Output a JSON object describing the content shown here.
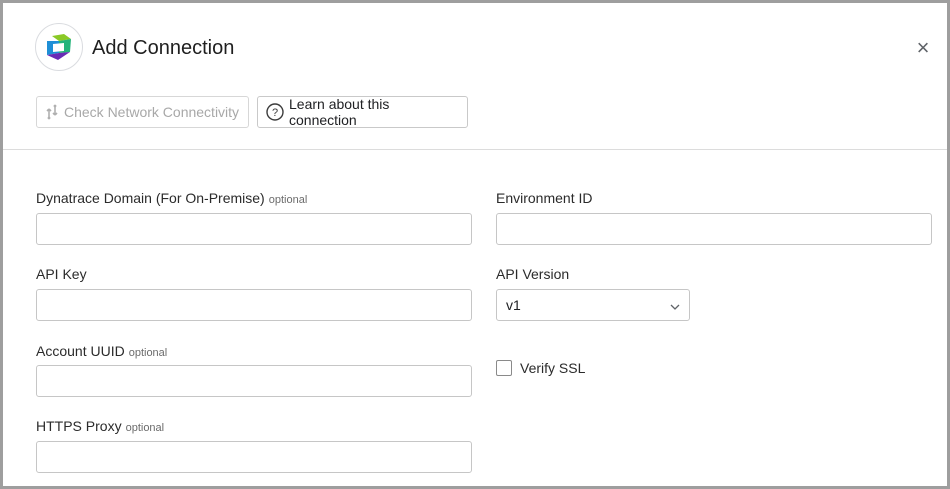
{
  "dialog": {
    "title": "Add Connection",
    "logo_icon": "dynatrace-logo",
    "close_icon": "close-icon"
  },
  "toolbar": {
    "check_label": "Check Network Connectivity",
    "check_icon": "network-icon",
    "learn_label": "Learn about this connection",
    "learn_icon": "help-circle-icon"
  },
  "form": {
    "optional_tag": "optional",
    "domain": {
      "label": "Dynatrace Domain (For On-Premise)",
      "value": ""
    },
    "environment_id": {
      "label": "Environment ID",
      "value": ""
    },
    "api_key": {
      "label": "API Key",
      "value": ""
    },
    "api_version": {
      "label": "API Version",
      "value": "v1"
    },
    "account_uuid": {
      "label": "Account UUID",
      "value": ""
    },
    "verify_ssl": {
      "label": "Verify SSL",
      "checked": false
    },
    "https_proxy": {
      "label": "HTTPS Proxy",
      "value": ""
    }
  },
  "colors": {
    "logo_green": "#8ac926",
    "logo_blue": "#1f8fd6",
    "logo_purple": "#6a2bb5",
    "logo_teal": "#23b37a"
  }
}
